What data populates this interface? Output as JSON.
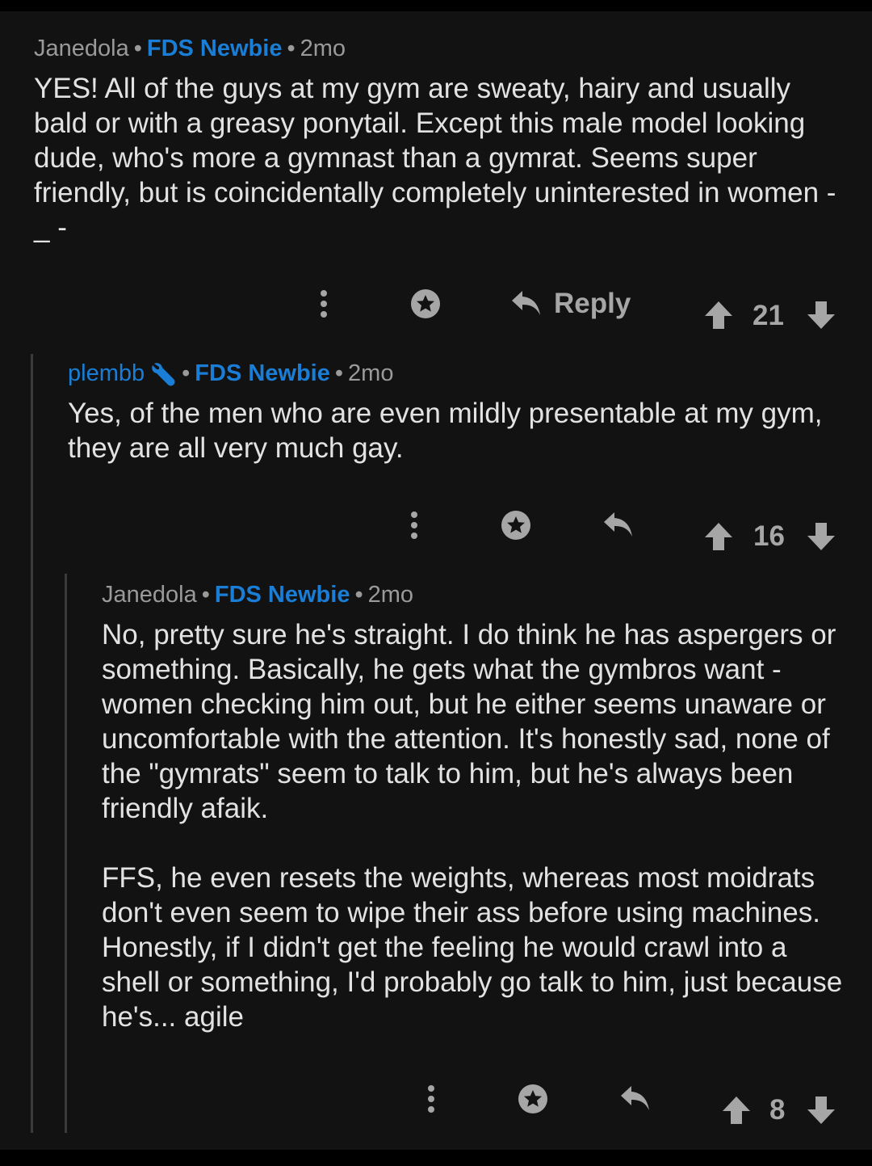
{
  "colors": {
    "background": "#121212",
    "frame": "#000000",
    "text": "#e2e2e2",
    "meta": "#9a9a9a",
    "accent_blue": "#1a7ed6",
    "icon": "#a6a6a6",
    "thread_line": "#3a3a3a"
  },
  "comments": [
    {
      "username": "Janedola",
      "flair": "FDS Newbie",
      "age": "2mo",
      "paragraphs": [
        "YES! All of the guys at my gym are sweaty, hairy and usually bald or with a greasy ponytail. Except this male model looking dude, who's more a gymnast than a gymrat. Seems super friendly, but is coincidentally completely uninterested in women - _ -"
      ],
      "reply_label": "Reply",
      "score": "21",
      "icons": [
        "more-vertical-icon",
        "award-icon",
        "reply-icon",
        "upvote-icon",
        "downvote-icon"
      ]
    },
    {
      "username": "plembb",
      "badge_icon": "wrench-icon",
      "flair": "FDS Newbie",
      "age": "2mo",
      "paragraphs": [
        "Yes, of the men who are even mildly presentable at my gym, they are all very much gay."
      ],
      "score": "16",
      "icons": [
        "more-vertical-icon",
        "award-icon",
        "reply-icon",
        "upvote-icon",
        "downvote-icon"
      ]
    },
    {
      "username": "Janedola",
      "flair": "FDS Newbie",
      "age": "2mo",
      "paragraphs": [
        "No, pretty sure he's straight. I do think he has aspergers or something. Basically, he gets what the gymbros want - women checking him out, but he either seems unaware or uncomfortable with the attention. It's honestly sad, none of the \"gymrats\" seem to talk to him, but he's always been friendly afaik.",
        "FFS, he even resets the weights, whereas most moidrats don't even seem to wipe their ass before using machines. Honestly, if I didn't get the feeling he would crawl into a shell or something, I'd probably go talk to him, just because he's... agile"
      ],
      "score": "8",
      "icons": [
        "more-vertical-icon",
        "award-icon",
        "reply-icon",
        "upvote-icon",
        "downvote-icon"
      ]
    }
  ],
  "separator": "•"
}
